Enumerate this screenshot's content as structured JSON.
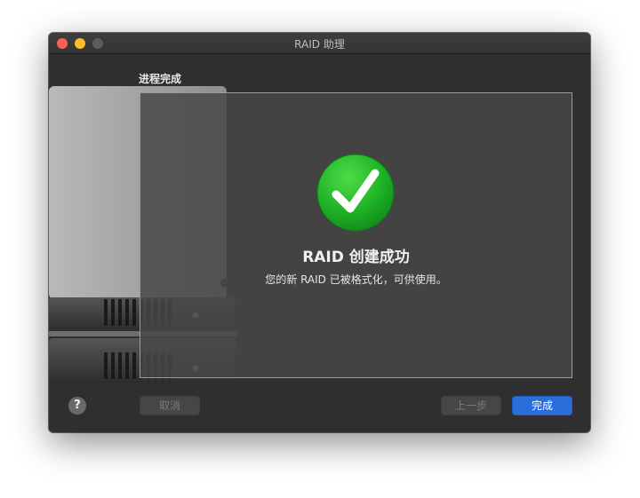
{
  "window": {
    "title": "RAID 助理"
  },
  "step": {
    "heading": "进程完成"
  },
  "result": {
    "title": "RAID 创建成功",
    "description": "您的新 RAID 已被格式化，可供使用。",
    "icon": "checkmark-success-icon"
  },
  "buttons": {
    "help": "?",
    "cancel": "取消",
    "back": "上一步",
    "done": "完成"
  },
  "colors": {
    "accent": "#2b6dd9",
    "success": "#1fa82a",
    "close": "#fc5f57",
    "minimize": "#fdbc2e"
  }
}
